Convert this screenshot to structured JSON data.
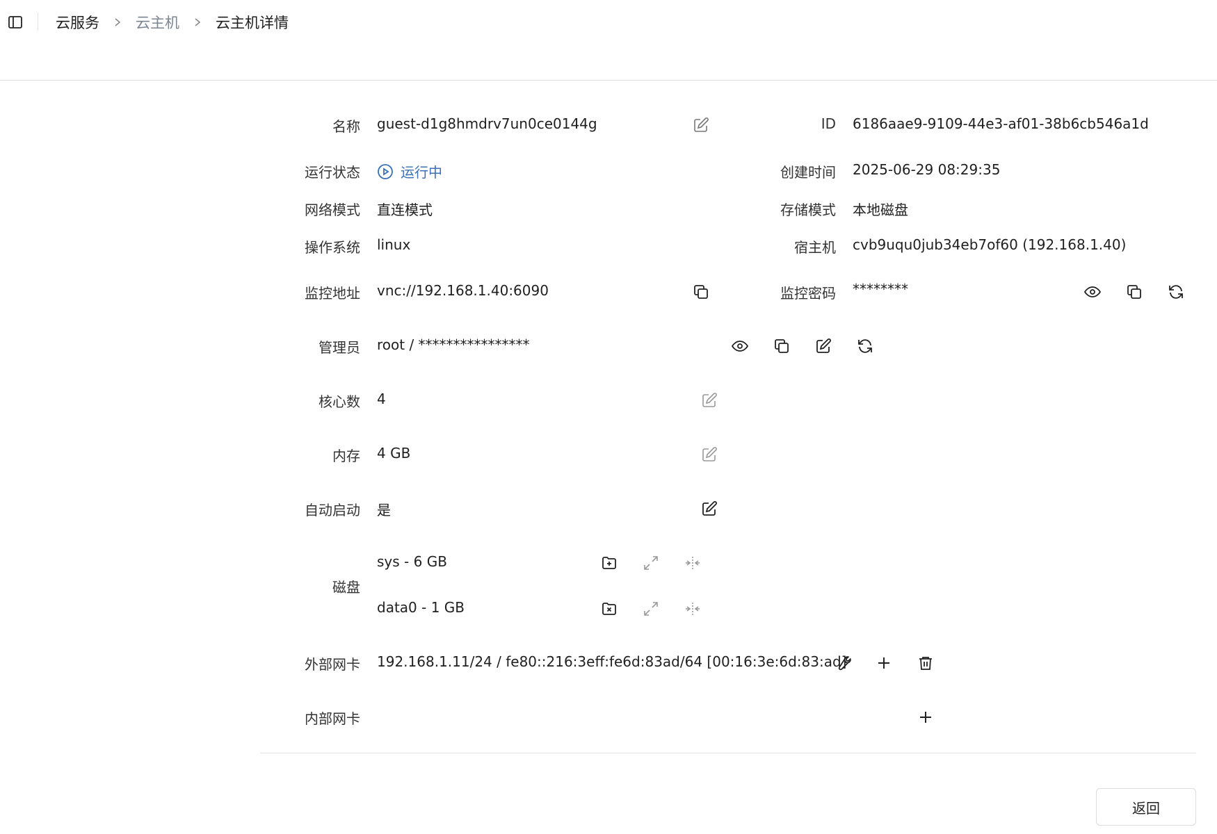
{
  "breadcrumb": {
    "items": [
      "云服务",
      "云主机",
      "云主机详情"
    ]
  },
  "details": {
    "name": {
      "label": "名称",
      "value": "guest-d1g8hmdrv7un0ce0144g"
    },
    "id": {
      "label": "ID",
      "value": "6186aae9-9109-44e3-af01-38b6cb546a1d"
    },
    "run_status": {
      "label": "运行状态",
      "value": "运行中",
      "color": "#3b6fb6"
    },
    "created_at": {
      "label": "创建时间",
      "value": "2025-06-29 08:29:35"
    },
    "network_mode": {
      "label": "网络模式",
      "value": "直连模式"
    },
    "storage_mode": {
      "label": "存储模式",
      "value": "本地磁盘"
    },
    "os": {
      "label": "操作系统",
      "value": "linux"
    },
    "host": {
      "label": "宿主机",
      "value": "cvb9uqu0jub34eb7of60 (192.168.1.40)"
    },
    "monitor_address": {
      "label": "监控地址",
      "value": "vnc://192.168.1.40:6090"
    },
    "monitor_password": {
      "label": "监控密码",
      "value": "********"
    },
    "admin": {
      "label": "管理员",
      "value": "root / ****************"
    },
    "cores": {
      "label": "核心数",
      "value": "4"
    },
    "memory": {
      "label": "内存",
      "value": "4 GB"
    },
    "autostart": {
      "label": "自动启动",
      "value": "是"
    },
    "disks": {
      "label": "磁盘",
      "items": [
        {
          "value": "sys - 6 GB"
        },
        {
          "value": "data0 - 1 GB"
        }
      ]
    },
    "external_nic": {
      "label": "外部网卡",
      "value": "192.168.1.11/24 / fe80::216:3eff:fe6d:83ad/64 [00:16:3e:6d:83:ad]"
    },
    "internal_nic": {
      "label": "内部网卡"
    }
  },
  "actions": {
    "back_label": "返回"
  },
  "icons": {
    "sidebar_toggle": "sidebar-toggle-icon",
    "edit": "edit-icon",
    "copy": "copy-icon",
    "eye": "eye-icon",
    "refresh": "refresh-icon",
    "add_disk": "folder-plus-icon",
    "remove_disk": "folder-x-icon",
    "expand": "expand-icon",
    "shrink": "shrink-icon",
    "wrench": "wrench-icon",
    "add": "plus-icon",
    "delete": "trash-icon",
    "play": "play-circle-icon"
  }
}
